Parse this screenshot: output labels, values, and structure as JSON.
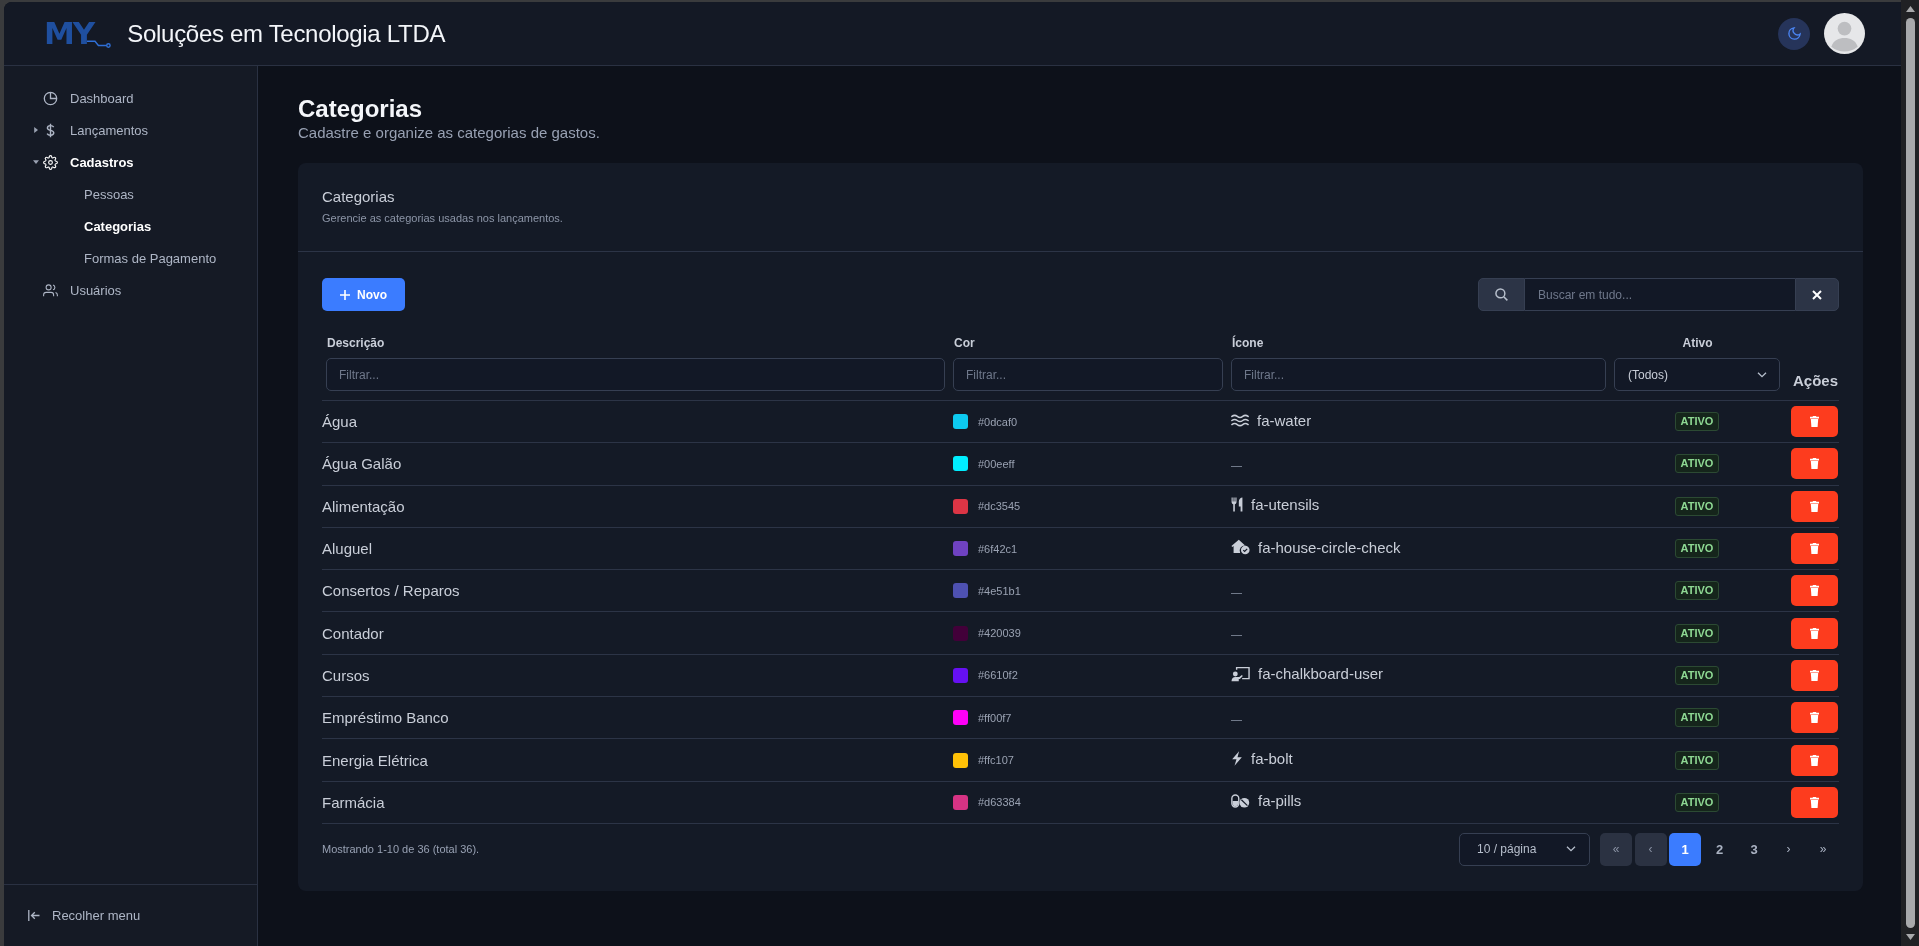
{
  "window": {
    "logo": "MY",
    "title": "Soluções em Tecnologia LTDA"
  },
  "sidebar": {
    "items": [
      {
        "label": "Dashboard",
        "selected": false
      },
      {
        "label": "Lançamentos",
        "selected": false,
        "expanded": false
      },
      {
        "label": "Cadastros",
        "selected": false,
        "expanded": true,
        "children": [
          {
            "label": "Pessoas",
            "selected": false
          },
          {
            "label": "Categorias",
            "selected": true
          },
          {
            "label": "Formas de Pagamento",
            "selected": false
          }
        ]
      },
      {
        "label": "Usuários",
        "selected": false
      }
    ],
    "collapse": "Recolher menu"
  },
  "page": {
    "title": "Categorias",
    "subtitle": "Cadastre e organize as categorias de gastos."
  },
  "card": {
    "title": "Categorias",
    "subtitle": "Gerencie as categorias usadas nos lançamentos.",
    "new_button": "Novo",
    "search": {
      "placeholder": "Buscar em tudo..."
    }
  },
  "table": {
    "columns": [
      {
        "label": "Descrição",
        "kind": "text",
        "placeholder": "Filtrar..."
      },
      {
        "label": "Cor",
        "kind": "text",
        "placeholder": "Filtrar..."
      },
      {
        "label": "Ícone",
        "kind": "text",
        "placeholder": "Filtrar..."
      },
      {
        "label": "Ativo",
        "kind": "select",
        "value": "(Todos)"
      },
      {
        "label": "Ações",
        "kind": "actions"
      }
    ],
    "rows": [
      {
        "description": "Água",
        "color": "#0dcaf0",
        "hex": "#0dcaf0",
        "icon": "fa-water",
        "status": "ATIVO",
        "active": true
      },
      {
        "description": "Água Galão",
        "color": "#00eeff",
        "hex": "#00eeff",
        "icon": "—",
        "status": "ATIVO",
        "active": true
      },
      {
        "description": "Alimentação",
        "color": "#dc3545",
        "hex": "#dc3545",
        "icon": "fa-utensils",
        "status": "ATIVO",
        "active": true
      },
      {
        "description": "Aluguel",
        "color": "#6f42c1",
        "hex": "#6f42c1",
        "icon": "fa-house-circle-check",
        "status": "ATIVO",
        "active": true
      },
      {
        "description": "Consertos / Reparos",
        "color": "#4e51b1",
        "hex": "#4e51b1",
        "icon": "—",
        "status": "ATIVO",
        "active": true
      },
      {
        "description": "Contador",
        "color": "#420039",
        "hex": "#420039",
        "icon": "—",
        "status": "ATIVO",
        "active": true
      },
      {
        "description": "Cursos",
        "color": "#6610f2",
        "hex": "#6610f2",
        "icon": "fa-chalkboard-user",
        "status": "ATIVO",
        "active": true
      },
      {
        "description": "Empréstimo Banco",
        "color": "#ff00f7",
        "hex": "#ff00f7",
        "icon": "—",
        "status": "ATIVO",
        "active": true
      },
      {
        "description": "Energia Elétrica",
        "color": "#ffc107",
        "hex": "#ffc107",
        "icon": "fa-bolt",
        "status": "ATIVO",
        "active": true
      },
      {
        "description": "Farmácia",
        "color": "#d63384",
        "hex": "#d63384",
        "icon": "fa-pills",
        "status": "ATIVO",
        "active": true
      }
    ]
  },
  "footer": {
    "summary": "Mostrando 1-10 de 36 (total 36).",
    "page_size": "10 / página",
    "pagination": [
      {
        "label": "«",
        "kind": "nav",
        "selected": false,
        "disabled": true
      },
      {
        "label": "‹",
        "kind": "nav",
        "selected": false,
        "disabled": true
      },
      {
        "label": "1",
        "kind": "page",
        "selected": true,
        "disabled": false
      },
      {
        "label": "2",
        "kind": "page",
        "selected": false,
        "disabled": false
      },
      {
        "label": "3",
        "kind": "page",
        "selected": false,
        "disabled": false
      },
      {
        "label": "›",
        "kind": "nav",
        "selected": false,
        "disabled": false
      },
      {
        "label": "»",
        "kind": "nav",
        "selected": false,
        "disabled": false
      }
    ]
  }
}
